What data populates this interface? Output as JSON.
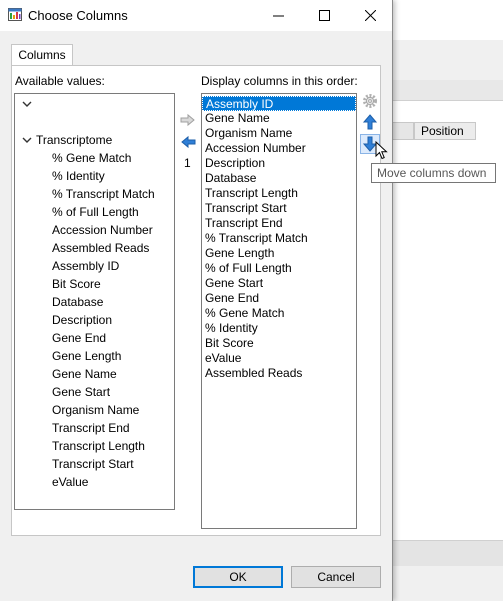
{
  "window": {
    "title": "Choose Columns",
    "minimize_glyph": "—",
    "maximize_glyph": "☐",
    "close_glyph": "✕"
  },
  "tabs": [
    {
      "label": "Columns"
    }
  ],
  "available": {
    "label": "Available values:",
    "root_group": "Transcriptome",
    "items": [
      "% Gene Match",
      "% Identity",
      "% Transcript Match",
      "% of Full Length",
      "Accession Number",
      "Assembled Reads",
      "Assembly ID",
      "Bit Score",
      "Database",
      "Description",
      "Gene End",
      "Gene Length",
      "Gene Name",
      "Gene Start",
      "Organism Name",
      "Transcript End",
      "Transcript Length",
      "Transcript Start",
      "eValue"
    ]
  },
  "middle": {
    "count_label": "1"
  },
  "display": {
    "label": "Display columns in this order:",
    "selected_index": 0,
    "items": [
      "Assembly ID",
      "Gene Name",
      "Organism Name",
      "Accession Number",
      "Description",
      "Database",
      "Transcript Length",
      "Transcript Start",
      "Transcript End",
      "% Transcript Match",
      "Gene Length",
      "% of Full Length",
      "Gene Start",
      "Gene End",
      "% Gene Match",
      "% Identity",
      "Bit Score",
      "eValue",
      "Assembled Reads"
    ]
  },
  "tooltip": "Move columns down",
  "buttons": {
    "ok": "OK",
    "cancel": "Cancel"
  },
  "background": {
    "column_header": "Position"
  },
  "colors": {
    "selection": "#0078d7",
    "arrow_blue": "#2f7fd7"
  }
}
